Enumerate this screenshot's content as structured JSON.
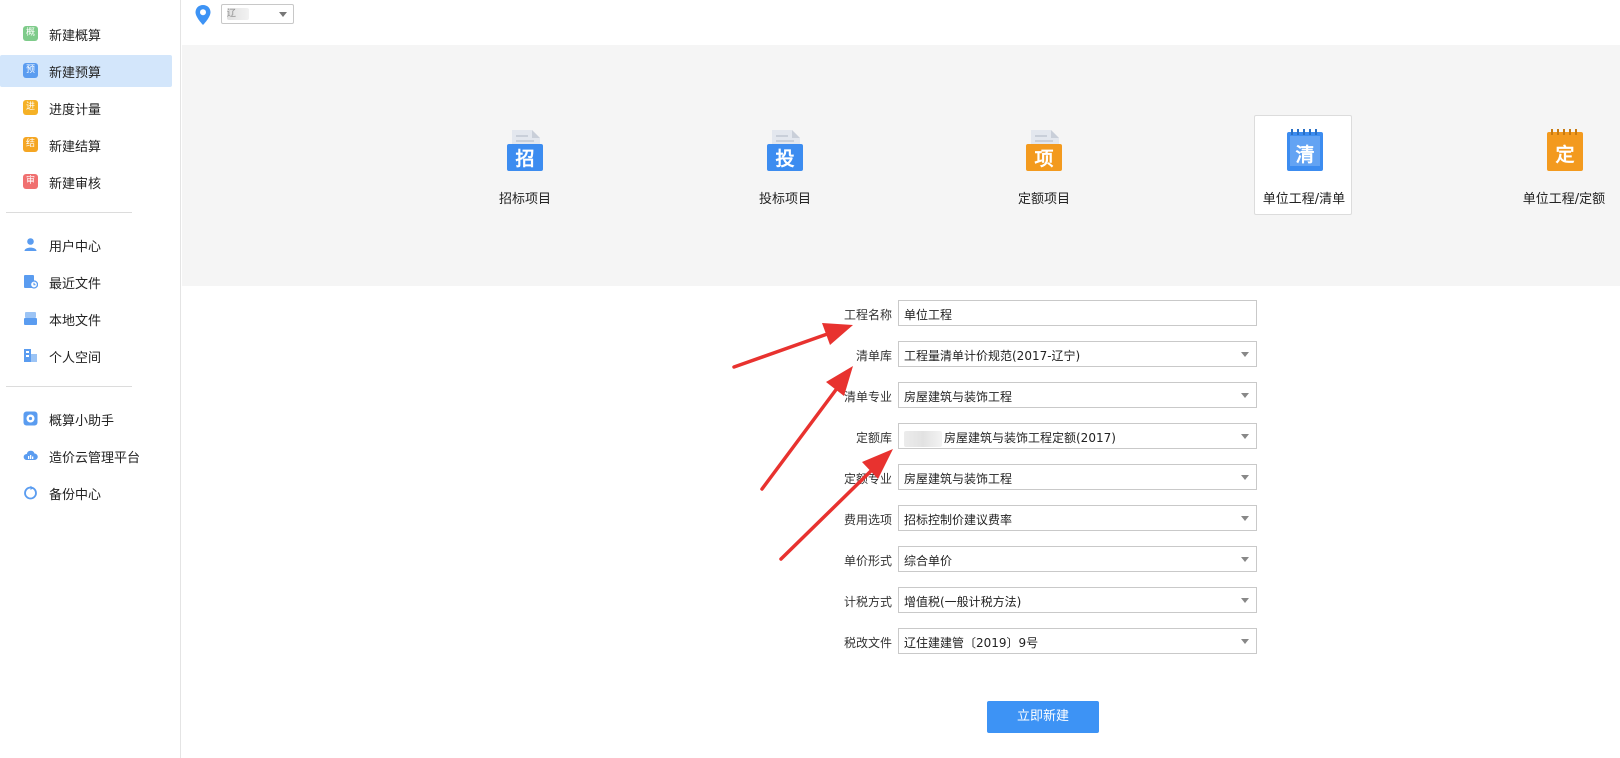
{
  "sidebar": {
    "groups": [
      [
        {
          "label": "新建概算",
          "icon": "estimate-icon",
          "glyph": "概",
          "color": "#7ecb8a"
        },
        {
          "label": "新建预算",
          "icon": "budget-icon",
          "glyph": "预",
          "color": "#5a9cf0",
          "active": true
        },
        {
          "label": "进度计量",
          "icon": "progress-icon",
          "glyph": "进",
          "color": "#f5b126"
        },
        {
          "label": "新建结算",
          "icon": "settlement-icon",
          "glyph": "结",
          "color": "#f5a623"
        },
        {
          "label": "新建审核",
          "icon": "audit-icon",
          "glyph": "审",
          "color": "#f07070"
        }
      ],
      [
        {
          "label": "用户中心",
          "icon": "user-icon"
        },
        {
          "label": "最近文件",
          "icon": "recent-files-icon"
        },
        {
          "label": "本地文件",
          "icon": "local-files-icon"
        },
        {
          "label": "个人空间",
          "icon": "personal-space-icon"
        }
      ],
      [
        {
          "label": "概算小助手",
          "icon": "assistant-icon"
        },
        {
          "label": "造价云管理平台",
          "icon": "cloud-platform-icon"
        },
        {
          "label": "备份中心",
          "icon": "backup-icon"
        }
      ]
    ]
  },
  "topbar": {
    "region_value": "辽"
  },
  "project_types": [
    {
      "label": "招标项目",
      "glyph": "招",
      "color": "#3c8cf0"
    },
    {
      "label": "投标项目",
      "glyph": "投",
      "color": "#3c8cf0"
    },
    {
      "label": "定额项目",
      "glyph": "项",
      "color": "#f39a1e"
    },
    {
      "label": "单位工程/清单",
      "glyph": "清",
      "color": "#3c8cf0",
      "selected": true
    },
    {
      "label": "单位工程/定额",
      "glyph": "定",
      "color": "#f39a1e"
    }
  ],
  "form": {
    "project_name": {
      "label": "工程名称",
      "value": "单位工程"
    },
    "bill_library": {
      "label": "清单库",
      "value": "工程量清单计价规范(2017-辽宁)"
    },
    "bill_specialty": {
      "label": "清单专业",
      "value": "房屋建筑与装饰工程"
    },
    "quota_library": {
      "label": "定额库",
      "value": "房屋建筑与装饰工程定额(2017)"
    },
    "quota_specialty": {
      "label": "定额专业",
      "value": "房屋建筑与装饰工程"
    },
    "fee_option": {
      "label": "费用选项",
      "value": "招标控制价建议费率"
    },
    "unit_price_form": {
      "label": "单价形式",
      "value": "综合单价"
    },
    "tax_method": {
      "label": "计税方式",
      "value": "增值税(一般计税方法)"
    },
    "tax_reform_doc": {
      "label": "税改文件",
      "value": "辽住建建管〔2019〕9号"
    },
    "submit_label": "立即新建"
  },
  "colors": {
    "accent": "#3d93f5",
    "sidebar_active": "#d3e6fb",
    "band_bg": "#f5f5f5",
    "annotation_arrow": "#e8322f"
  }
}
